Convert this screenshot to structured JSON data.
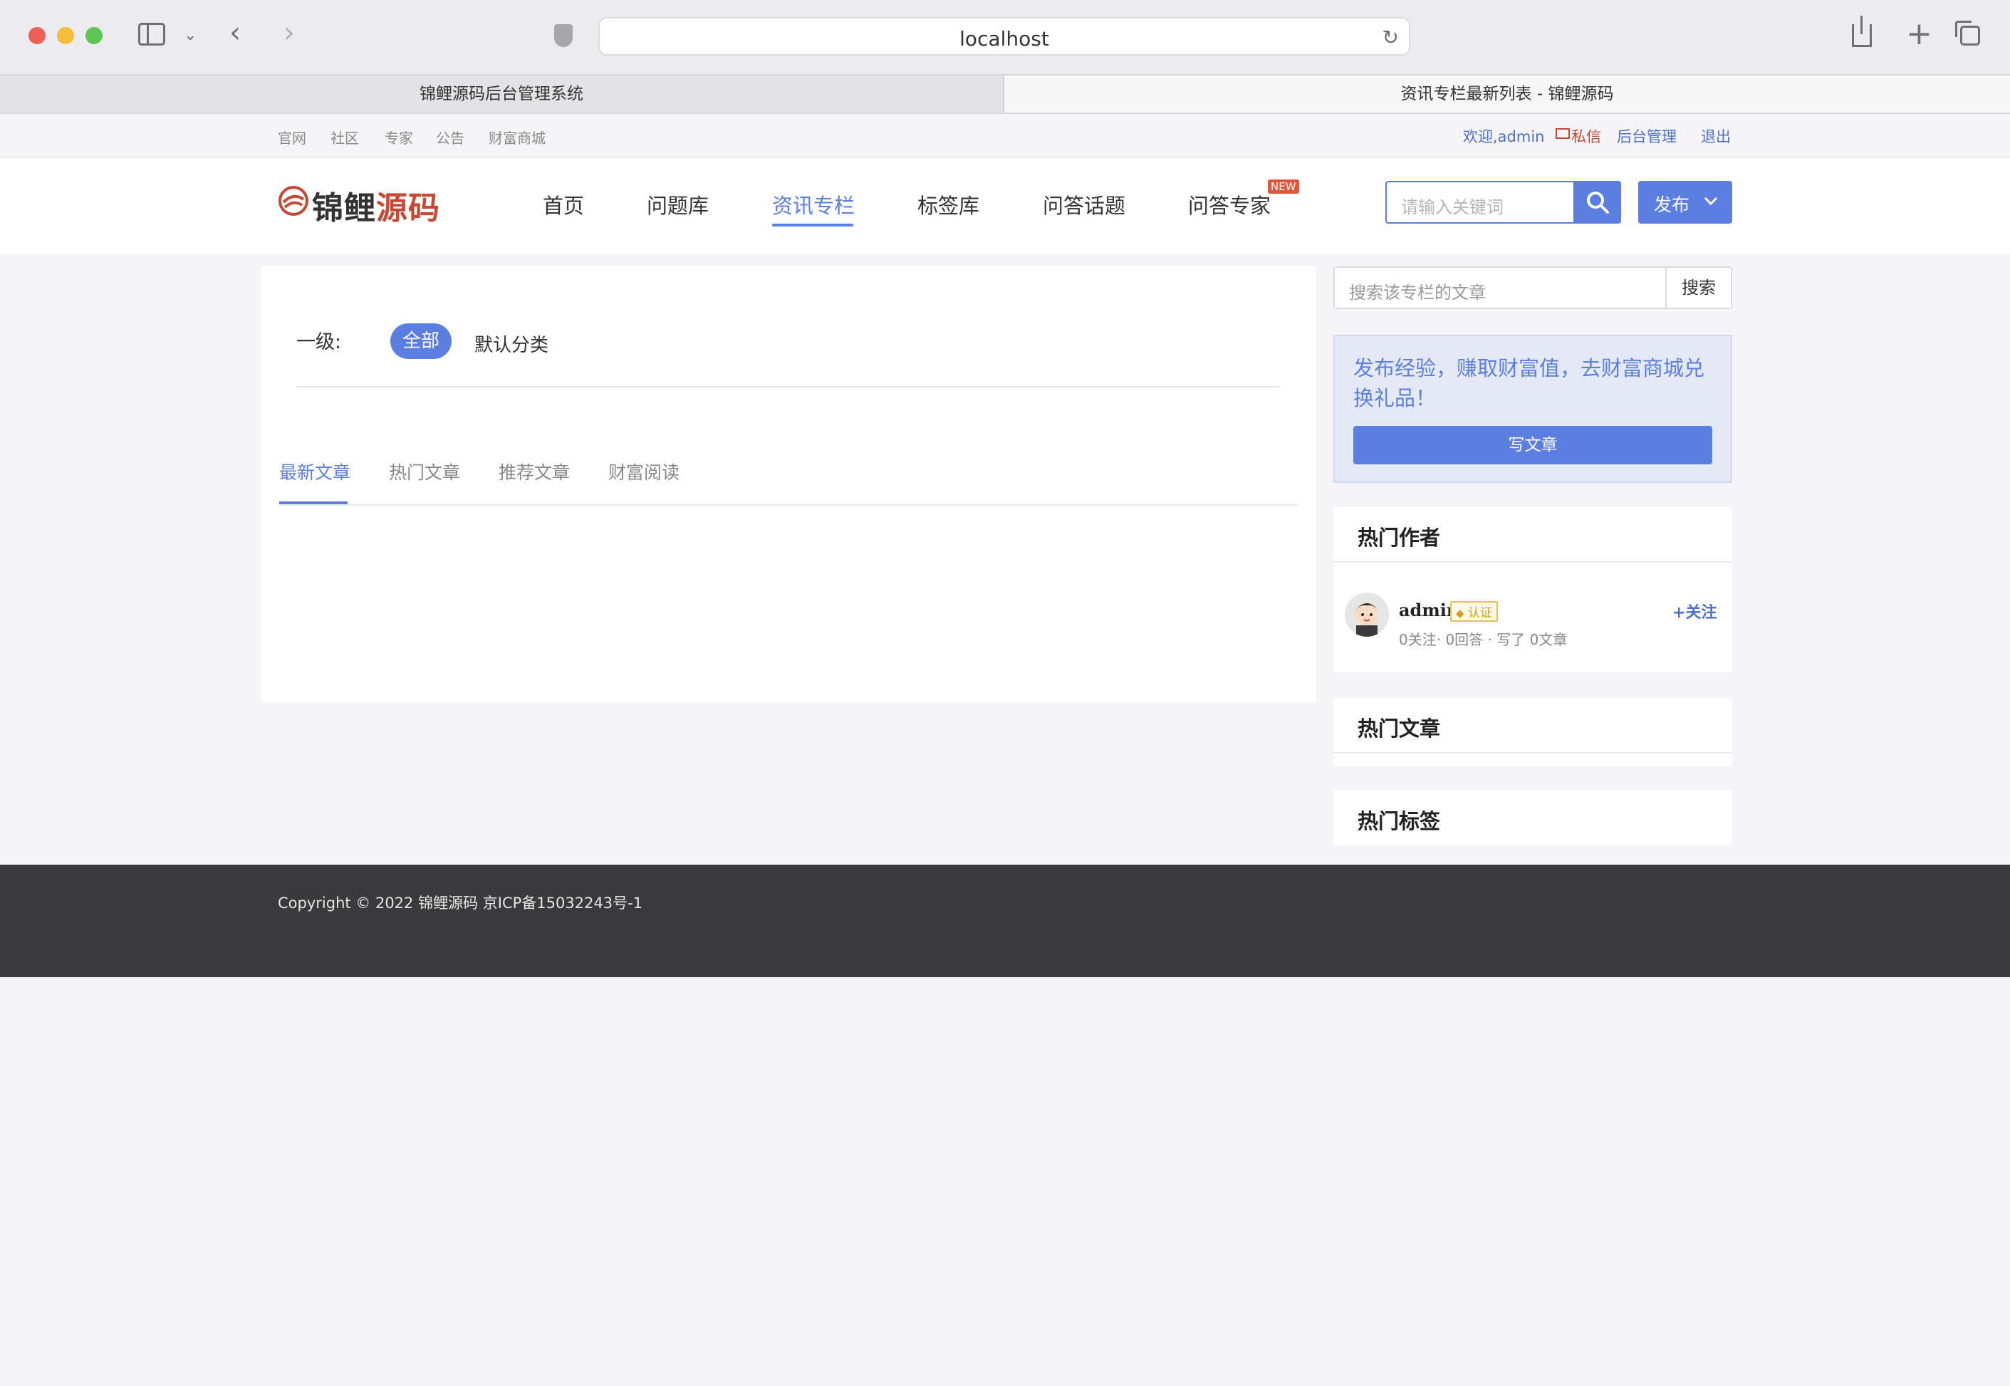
{
  "browser": {
    "url": "localhost",
    "tabs": [
      {
        "label": "锦鲤源码后台管理系统"
      },
      {
        "label": "资讯专栏最新列表 - 锦鲤源码"
      }
    ]
  },
  "topbar": {
    "left_links": [
      "官网",
      "社区",
      "专家",
      "公告",
      "财富商城"
    ],
    "welcome": "欢迎,admin",
    "message": "私信",
    "admin_panel": "后台管理",
    "logout": "退出"
  },
  "header": {
    "logo_part1": "锦鲤",
    "logo_part2": "源码",
    "nav": [
      "首页",
      "问题库",
      "资讯专栏",
      "标签库",
      "问答话题",
      "问答专家"
    ],
    "new_badge": "NEW",
    "search_placeholder": "请输入关键词",
    "publish": "发布"
  },
  "filters": {
    "level_label": "一级:",
    "chips": [
      "全部",
      "默认分类"
    ]
  },
  "article_tabs": [
    "最新文章",
    "热门文章",
    "推荐文章",
    "财富阅读"
  ],
  "sidebar": {
    "search_placeholder": "搜索该专栏的文章",
    "search_button": "搜索",
    "promo_text": "发布经验，赚取财富值，去财富商城兑换礼品！",
    "write_button": "写文章",
    "hot_authors_title": "热门作者",
    "author": {
      "name": "admin",
      "badge": "认证",
      "stats": "0关注· 0回答 · 写了 0文章",
      "follow": "关注"
    },
    "hot_articles_title": "热门文章",
    "hot_tags_title": "热门标签"
  },
  "footer": {
    "copyright": "Copyright © 2022 锦鲤源码 京ICP备15032243号-1"
  },
  "colors": {
    "accent": "#5b7fe0",
    "footer_bg": "#3a3a3c",
    "logo_red": "#c44a35"
  }
}
